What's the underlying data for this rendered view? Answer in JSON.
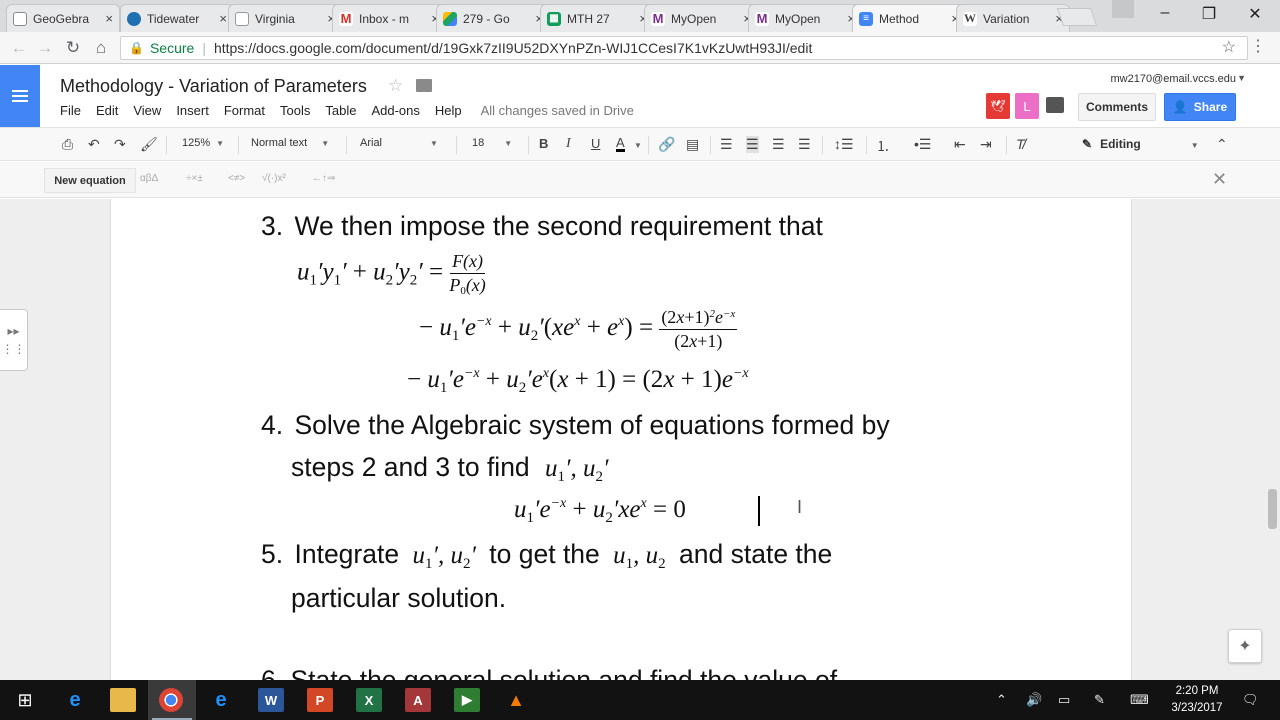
{
  "browser": {
    "tabs": [
      {
        "label": "GeoGebra",
        "icon": "geogebra-icon",
        "color": "#666666"
      },
      {
        "label": "Tidewater",
        "icon": "tidewater-icon",
        "color": "#1f6fb2"
      },
      {
        "label": "Virginia",
        "icon": "page-icon",
        "color": "#999999"
      },
      {
        "label": "Inbox - m",
        "icon": "gmail-icon",
        "color": "#d93025"
      },
      {
        "label": "279 - Go",
        "icon": "drive-icon",
        "color": "#1fa463"
      },
      {
        "label": "MTH 27",
        "icon": "sheets-icon",
        "color": "#0f9d58"
      },
      {
        "label": "MyOpen",
        "icon": "myopenmath-icon",
        "color": "#7b2c91"
      },
      {
        "label": "MyOpen",
        "icon": "myopenmath-icon",
        "color": "#7b2c91"
      },
      {
        "label": "Method",
        "icon": "docs-icon",
        "color": "#4285f4",
        "active": true
      },
      {
        "label": "Variation",
        "icon": "wikipedia-icon",
        "color": "#444444"
      }
    ],
    "close_glyph": "×",
    "secure_label": "Secure",
    "url": "https://docs.google.com/document/d/19Gxk7zII9U52DXYnPZn-WIJ1CCesI7K1vKzUwtH93JI/edit"
  },
  "docs": {
    "title": "Methodology - Variation of Parameters",
    "menu": [
      "File",
      "Edit",
      "View",
      "Insert",
      "Format",
      "Tools",
      "Table",
      "Add-ons",
      "Help"
    ],
    "save_status": "All changes saved in Drive",
    "account_email": "mw2170@email.vccs.edu",
    "addon_letter": "L",
    "comments_label": "Comments",
    "share_label": "Share",
    "accent": "#4285f4"
  },
  "toolbar": {
    "zoom": "125%",
    "style": "Normal text",
    "font": "Arial",
    "size": "18",
    "bold": "B",
    "italic": "I",
    "underline": "U",
    "text_color": "A",
    "mode": "Editing"
  },
  "equation_bar": {
    "new_equation_label": "New equation",
    "groups": [
      "αβΔ",
      "÷×±",
      "<≠>",
      "√(·)x²",
      "←↑⇒"
    ]
  },
  "content": {
    "item3_num": "3.",
    "item3_text": "We then impose the second requirement that",
    "item4_num": "4.",
    "item4_line1": "Solve the Algebraic system of equations formed by",
    "item4_line2": "steps 2 and 3 to find",
    "item5_num": "5.",
    "item5_a": "Integrate",
    "item5_b": "to get the",
    "item5_c": "and state the",
    "item5_line2": "particular solution.",
    "item6_cutoff": "6. State the general solution and find the value of"
  },
  "taskbar": {
    "time": "2:20 PM",
    "date": "3/23/2017"
  }
}
